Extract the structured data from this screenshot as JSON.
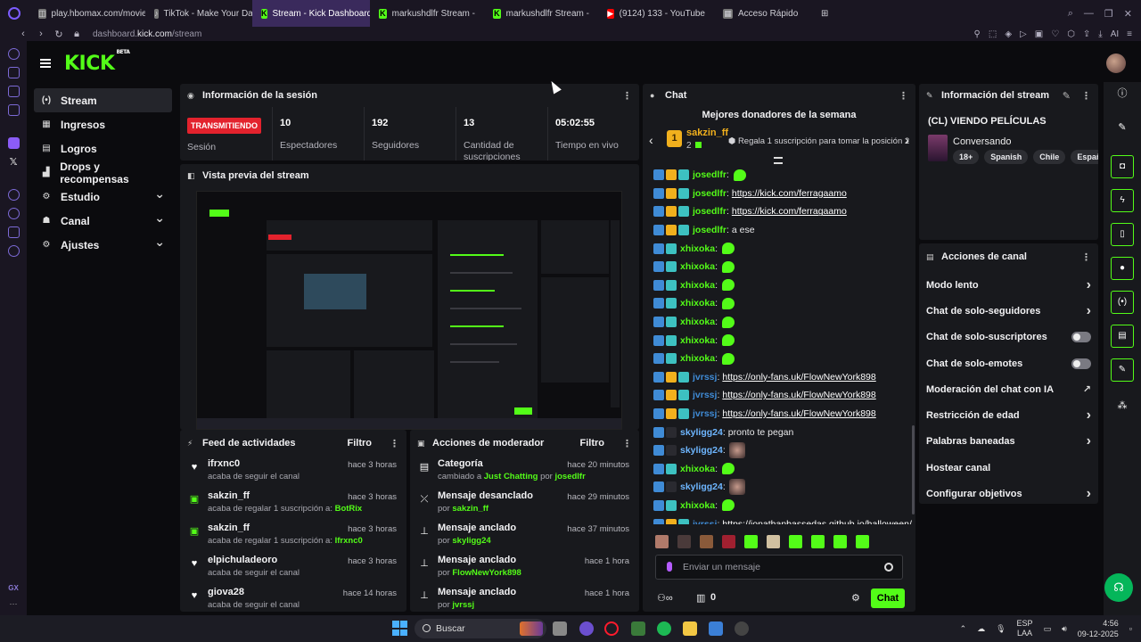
{
  "browser": {
    "tabs": [
      {
        "label": "play.hbomax.com/movies",
        "icon": "hbo-icon",
        "active": false
      },
      {
        "label": "TikTok - Make Your Day",
        "icon": "tiktok-icon",
        "active": false
      },
      {
        "label": "Stream - Kick Dashboard",
        "icon": "kick-icon",
        "active": true
      },
      {
        "label": "markushdlfr Stream -",
        "icon": "kick-icon",
        "active": false
      },
      {
        "label": "markushdlfr Stream -",
        "icon": "kick-icon",
        "active": false
      },
      {
        "label": "(9124) 133 - YouTube",
        "icon": "youtube-icon",
        "active": false
      },
      {
        "label": "Acceso Rápido",
        "icon": "grid-icon",
        "active": false
      }
    ],
    "url_prefix": "dashboard.",
    "url_domain": "kick.com",
    "url_path": "/stream",
    "ai_label": "AI"
  },
  "opera_sidebar": {
    "gx_label": "GX",
    "more_label": "···"
  },
  "header": {
    "logo": "KICK",
    "logo_sup": "BETA"
  },
  "nav": {
    "items": [
      {
        "label": "Stream",
        "icon": "stream-icon",
        "active": true,
        "chevron": false
      },
      {
        "label": "Ingresos",
        "icon": "income-icon",
        "active": false,
        "chevron": false
      },
      {
        "label": "Logros",
        "icon": "achievements-icon",
        "active": false,
        "chevron": false
      },
      {
        "label": "Drops y recompensas",
        "icon": "drops-icon",
        "active": false,
        "chevron": false
      },
      {
        "label": "Estudio",
        "icon": "studio-icon",
        "active": false,
        "chevron": true
      },
      {
        "label": "Canal",
        "icon": "channel-icon",
        "active": false,
        "chevron": true
      },
      {
        "label": "Ajustes",
        "icon": "settings-icon",
        "active": false,
        "chevron": true
      }
    ]
  },
  "session": {
    "title": "Información de la sesión",
    "live_badge": "TRANSMITIENDO",
    "session_label": "Sesión",
    "stats": [
      {
        "value": "10",
        "label": "Espectadores"
      },
      {
        "value": "192",
        "label": "Seguidores"
      },
      {
        "value": "13",
        "label": "Cantidad de suscripciones"
      },
      {
        "value": "05:02:55",
        "label": "Tiempo en vivo"
      }
    ]
  },
  "preview": {
    "title": "Vista previa del stream"
  },
  "activity": {
    "title": "Feed de actividades",
    "filter": "Filtro",
    "items": [
      {
        "icon": "heart-icon",
        "green": false,
        "name": "ifrxnc0",
        "sub": "acaba de seguir el canal",
        "sub2": "",
        "target": "",
        "time": "hace 3 horas"
      },
      {
        "icon": "gift-icon",
        "green": true,
        "name": "sakzin_ff",
        "sub": "acaba de regalar ",
        "sub2": "1 suscripción a: ",
        "target": "BotRix",
        "time": "hace 3 horas"
      },
      {
        "icon": "gift-icon",
        "green": true,
        "name": "sakzin_ff",
        "sub": "acaba de regalar ",
        "sub2": "1 suscripción a: ",
        "target": "Ifrxnc0",
        "time": "hace 3 horas"
      },
      {
        "icon": "heart-icon",
        "green": false,
        "name": "elpichuladeoro",
        "sub": "acaba de seguir el canal",
        "sub2": "",
        "target": "",
        "time": "hace 3 horas"
      },
      {
        "icon": "heart-icon",
        "green": false,
        "name": "giova28",
        "sub": "acaba de seguir el canal",
        "sub2": "",
        "target": "",
        "time": "hace 14 horas"
      }
    ]
  },
  "moderator": {
    "title": "Acciones de moderador",
    "filter": "Filtro",
    "items": [
      {
        "icon": "category-icon",
        "name": "Categoría",
        "pre": "cambiado a ",
        "hl": "Just Chatting",
        "mid": " por ",
        "hl2": "josedlfr",
        "time": "hace 20 minutos"
      },
      {
        "icon": "unpin-icon",
        "name": "Mensaje desanclado",
        "pre": "por ",
        "hl": "sakzin_ff",
        "mid": "",
        "hl2": "",
        "time": "hace 29 minutos"
      },
      {
        "icon": "pin-icon",
        "name": "Mensaje anclado",
        "pre": "por ",
        "hl": "skyligg24",
        "mid": "",
        "hl2": "",
        "time": "hace 37 minutos"
      },
      {
        "icon": "pin-icon",
        "name": "Mensaje anclado",
        "pre": "por ",
        "hl": "FlowNewYork898",
        "mid": "",
        "hl2": "",
        "time": "hace 1 hora"
      },
      {
        "icon": "pin-icon",
        "name": "Mensaje anclado",
        "pre": "por ",
        "hl": "jvrssj",
        "mid": "",
        "hl2": "",
        "time": "hace 1 hora"
      }
    ]
  },
  "chat": {
    "title": "Chat",
    "donors_title": "Mejores donadores de la semana",
    "donor_rank": "1",
    "donor_name": "sakzin_ff",
    "donor_count": "2",
    "donor_cta": "Regala 1 suscripción para tomar la posición 2",
    "messages": [
      {
        "user": "josedlfr",
        "color": "#53fc18",
        "badges": 3,
        "text": "",
        "link": "",
        "emote": "green"
      },
      {
        "user": "josedlfr",
        "color": "#53fc18",
        "badges": 3,
        "text": "",
        "link": "https://kick.com/ferragaamo",
        "emote": ""
      },
      {
        "user": "josedlfr",
        "color": "#53fc18",
        "badges": 3,
        "text": "",
        "link": "https://kick.com/ferragaamo",
        "emote": ""
      },
      {
        "user": "josedlfr",
        "color": "#53fc18",
        "badges": 3,
        "text": "a ese",
        "link": "",
        "emote": ""
      },
      {
        "user": "xhixoka",
        "color": "#53fc18",
        "badges": 2,
        "text": "",
        "link": "",
        "emote": "green"
      },
      {
        "user": "xhixoka",
        "color": "#53fc18",
        "badges": 2,
        "text": "",
        "link": "",
        "emote": "green"
      },
      {
        "user": "xhixoka",
        "color": "#53fc18",
        "badges": 2,
        "text": "",
        "link": "",
        "emote": "green"
      },
      {
        "user": "xhixoka",
        "color": "#53fc18",
        "badges": 2,
        "text": "",
        "link": "",
        "emote": "green"
      },
      {
        "user": "xhixoka",
        "color": "#53fc18",
        "badges": 2,
        "text": "",
        "link": "",
        "emote": "green"
      },
      {
        "user": "xhixoka",
        "color": "#53fc18",
        "badges": 2,
        "text": "",
        "link": "",
        "emote": "green"
      },
      {
        "user": "xhixoka",
        "color": "#53fc18",
        "badges": 2,
        "text": "",
        "link": "",
        "emote": "green"
      },
      {
        "user": "jvrssj",
        "color": "#3f8bd6",
        "badges": 3,
        "text": "",
        "link": "https://only-fans.uk/FlowNewYork898",
        "emote": ""
      },
      {
        "user": "jvrssj",
        "color": "#3f8bd6",
        "badges": 3,
        "text": "",
        "link": "https://only-fans.uk/FlowNewYork898",
        "emote": ""
      },
      {
        "user": "jvrssj",
        "color": "#3f8bd6",
        "badges": 3,
        "text": "",
        "link": "https://only-fans.uk/FlowNewYork898",
        "emote": ""
      },
      {
        "user": "skyligg24",
        "color": "#6eb6ff",
        "badges": 1,
        "text": "pronto te pegan",
        "link": "",
        "emote": ""
      },
      {
        "user": "skyligg24",
        "color": "#6eb6ff",
        "badges": 1,
        "text": "",
        "link": "",
        "emote": "face"
      },
      {
        "user": "xhixoka",
        "color": "#53fc18",
        "badges": 2,
        "text": "",
        "link": "",
        "emote": "green"
      },
      {
        "user": "skyligg24",
        "color": "#6eb6ff",
        "badges": 1,
        "text": "",
        "link": "",
        "emote": "face"
      },
      {
        "user": "xhixoka",
        "color": "#53fc18",
        "badges": 2,
        "text": "",
        "link": "",
        "emote": "green"
      },
      {
        "user": "jvrssj",
        "color": "#3f8bd6",
        "badges": 3,
        "text": "",
        "link": "https://jonathanbassedas.github.io/halloween/",
        "emote": ""
      }
    ],
    "input_placeholder": "Enviar un mensaje",
    "points": "0",
    "send_label": "Chat"
  },
  "stream_info": {
    "title": "Información del stream",
    "stream_title": "(CL) VIENDO PELÍCULAS",
    "category": "Conversando",
    "tags": [
      "18+",
      "Spanish",
      "Chile",
      "Español"
    ]
  },
  "channel_actions": {
    "title": "Acciones de canal",
    "items": [
      {
        "label": "Modo lento",
        "control": "chevron"
      },
      {
        "label": "Chat de solo-seguidores",
        "control": "chevron"
      },
      {
        "label": "Chat de solo-suscriptores",
        "control": "toggle"
      },
      {
        "label": "Chat de solo-emotes",
        "control": "toggle"
      },
      {
        "label": "Moderación del chat con IA",
        "control": "external"
      },
      {
        "label": "Restricción de edad",
        "control": "chevron"
      },
      {
        "label": "Palabras baneadas",
        "control": "chevron"
      },
      {
        "label": "Hostear canal",
        "control": "none"
      },
      {
        "label": "Configurar objetivos",
        "control": "chevron"
      }
    ]
  },
  "taskbar": {
    "search": "Buscar",
    "lang_top": "ESP",
    "lang_bottom": "LAA",
    "time": "4:56",
    "date": "09-12-2025"
  },
  "colors": {
    "kick_green": "#53fc18",
    "live_red": "#e3222d",
    "panel": "#18191d",
    "accent_purple": "#7c5cff"
  }
}
